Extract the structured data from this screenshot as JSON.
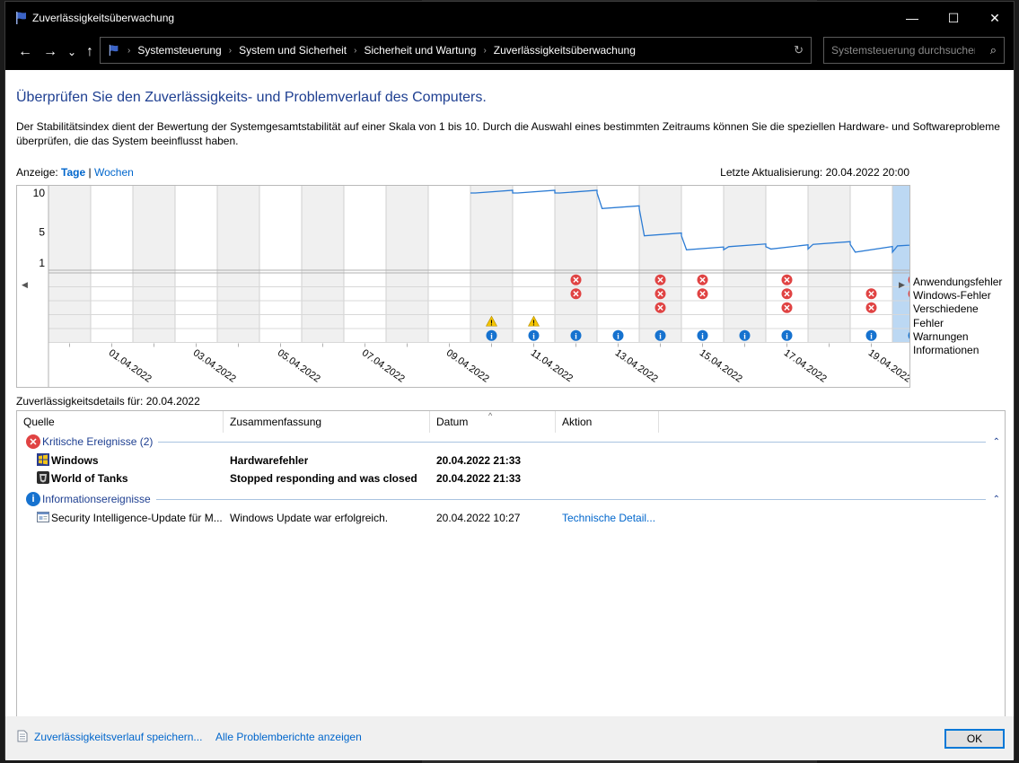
{
  "window": {
    "title": "Zuverlässigkeitsüberwachung",
    "controls": {
      "minimize": "—",
      "maximize": "☐",
      "close": "✕"
    }
  },
  "nav": {
    "back": "←",
    "forward": "→",
    "dropdown": "⌄",
    "up": "↑",
    "breadcrumbs": [
      "Systemsteuerung",
      "System und Sicherheit",
      "Sicherheit und Wartung",
      "Zuverlässigkeitsüberwachung"
    ],
    "separator": "›",
    "refresh": "↻",
    "search_placeholder": "Systemsteuerung durchsuchen",
    "search_icon": "⌕"
  },
  "page": {
    "heading": "Überprüfen Sie den Zuverlässigkeits- und Problemverlauf des Computers.",
    "description": "Der Stabilitätsindex dient der Bewertung der Systemgesamtstabilität auf einer Skala von 1 bis 10. Durch die Auswahl eines bestimmten Zeitraums können Sie die speziellen Hardware- und Softwareprobleme überprüfen, die das System beeinflusst haben.",
    "view_label": "Anzeige:",
    "view_days": "Tage",
    "view_sep": "|",
    "view_weeks": "Wochen",
    "last_update": "Letzte Aktualisierung: 20.04.2022 20:00"
  },
  "chart_data": {
    "type": "line",
    "title": "",
    "y_ticks": [
      "10",
      "5",
      "1"
    ],
    "ylim": [
      1,
      10
    ],
    "dates": [
      "31.03.2022",
      "01.04.2022",
      "02.04.2022",
      "03.04.2022",
      "04.04.2022",
      "05.04.2022",
      "06.04.2022",
      "07.04.2022",
      "08.04.2022",
      "09.04.2022",
      "10.04.2022",
      "11.04.2022",
      "12.04.2022",
      "13.04.2022",
      "14.04.2022",
      "15.04.2022",
      "16.04.2022",
      "17.04.2022",
      "18.04.2022",
      "19.04.2022",
      "20.04.2022"
    ],
    "x_tick_labels": [
      "01.04.2022",
      "03.04.2022",
      "05.04.2022",
      "07.04.2022",
      "09.04.2022",
      "11.04.2022",
      "13.04.2022",
      "15.04.2022",
      "17.04.2022",
      "19.04.2022"
    ],
    "selected_date": "20.04.2022",
    "stability_series": [
      {
        "date": "10.04.2022",
        "value": 10.0
      },
      {
        "date": "11.04.2022",
        "value": 10.0
      },
      {
        "date": "12.04.2022",
        "value": 10.0
      },
      {
        "date": "13.04.2022",
        "value": 8.0
      },
      {
        "date": "14.04.2022",
        "value": 4.5
      },
      {
        "date": "15.04.2022",
        "value": 2.7
      },
      {
        "date": "16.04.2022",
        "value": 3.1
      },
      {
        "date": "17.04.2022",
        "value": 2.8
      },
      {
        "date": "18.04.2022",
        "value": 3.4
      },
      {
        "date": "19.04.2022",
        "value": 2.4
      },
      {
        "date": "20.04.2022",
        "value": 3.2
      }
    ],
    "event_rows": [
      "Anwendungsfehler",
      "Windows-Fehler",
      "Verschiedene Fehler",
      "Warnungen",
      "Informationen"
    ],
    "events": {
      "Anwendungsfehler": [
        "12.04.2022",
        "14.04.2022",
        "15.04.2022",
        "17.04.2022",
        "20.04.2022"
      ],
      "Windows-Fehler": [
        "12.04.2022",
        "14.04.2022",
        "15.04.2022",
        "17.04.2022",
        "19.04.2022",
        "20.04.2022"
      ],
      "Verschiedene Fehler": [
        "14.04.2022",
        "17.04.2022",
        "19.04.2022"
      ],
      "Warnungen": [
        "10.04.2022",
        "11.04.2022"
      ],
      "Informationen": [
        "10.04.2022",
        "11.04.2022",
        "12.04.2022",
        "13.04.2022",
        "14.04.2022",
        "15.04.2022",
        "16.04.2022",
        "17.04.2022",
        "19.04.2022",
        "20.04.2022"
      ]
    },
    "grid": true
  },
  "details": {
    "title": "Zuverlässigkeitsdetails für: 20.04.2022",
    "columns": [
      "Quelle",
      "Zusammenfassung",
      "Datum",
      "Aktion"
    ],
    "sort_indicator": "^",
    "groups": [
      {
        "label": "Kritische Ereignisse (2)",
        "icon": "error-icon",
        "chevron": "⌃",
        "rows": [
          {
            "source": "Windows",
            "summary": "Hardwarefehler",
            "date": "20.04.2022 21:33",
            "action": "",
            "bold": true,
            "icon": "windows-shield-icon"
          },
          {
            "source": "World of Tanks",
            "summary": "Stopped responding and was closed",
            "date": "20.04.2022 21:33",
            "action": "",
            "bold": true,
            "icon": "world-of-tanks-icon"
          }
        ]
      },
      {
        "label": "Informationsereignisse",
        "icon": "info-icon",
        "chevron": "⌃",
        "rows": [
          {
            "source": "Security Intelligence-Update für M...",
            "summary": "Windows Update war erfolgreich.",
            "date": "20.04.2022 10:27",
            "action": "Technische Detail...",
            "bold": false,
            "icon": "update-icon"
          }
        ]
      }
    ]
  },
  "footer": {
    "save_link": "Zuverlässigkeitsverlauf speichern...",
    "reports_link": "Alle Problemberichte anzeigen",
    "ok_label": "OK"
  },
  "colors": {
    "accent": "#0078d7",
    "heading": "#1e3f91",
    "link": "#0066cc",
    "error": "#e04343",
    "warning": "#f4c400",
    "info": "#1672cf",
    "line": "#2b7bd4",
    "selected_column": "#bcd8f3"
  }
}
